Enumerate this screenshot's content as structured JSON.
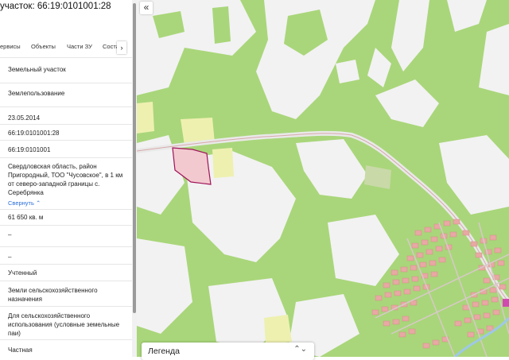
{
  "panel": {
    "title": "участок: 66:19:0101001:28",
    "tabs": [
      "ервисы",
      "Объекты",
      "Части ЗУ",
      "Соста"
    ],
    "tab_cut": "",
    "scroll_arrow": "›",
    "rows": [
      "Земельный участок",
      "Землепользование",
      "23.05.2014",
      "66:19:0101001:28",
      "66:19:0101001",
      "Свердловская область, район Пригородный, ТОО \"Чусовское\", в 1 км от северо-западной границы с. Серебрянка",
      "61 650 кв. м",
      "–",
      "–",
      "Учтенный",
      "Земли сельскохозяйственного назначения",
      "Для сельскохозяйственного использования (условные земельные паи)",
      "Частная"
    ],
    "collapse_link": "Свернуть ⌃"
  },
  "map": {
    "collapse_button": "«",
    "legend_label": "Легенда",
    "legend_chevron": "⌃⌄",
    "watermark": "",
    "colors": {
      "forest": "#a9d67a",
      "open_land": "#f2f2f2",
      "parcel_fill": "#f2c9cf",
      "parcel_stroke": "#a0145a",
      "road": "#e9e9e9",
      "buildings": "#e8a8a4",
      "field": "#eef0b0"
    }
  }
}
